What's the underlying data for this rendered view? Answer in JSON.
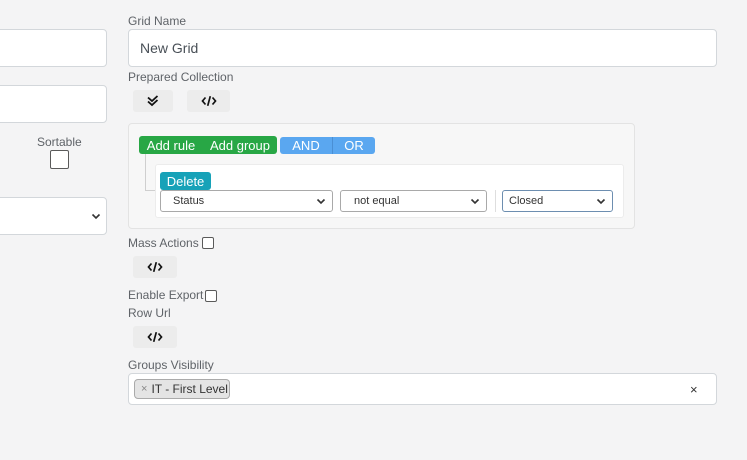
{
  "form": {
    "grid_name_label": "Grid Name",
    "grid_name_value": "New Grid",
    "prepared_collection_label": "Prepared Collection",
    "sortable_label": "Sortable",
    "mass_actions_label": "Mass Actions",
    "enable_export_label": "Enable Export",
    "row_url_label": "Row Url",
    "groups_visibility_label": "Groups Visibility"
  },
  "query_builder": {
    "add_rule_label": "Add rule",
    "add_group_label": "Add group",
    "and_label": "AND",
    "or_label": "OR",
    "delete_label": "Delete",
    "rule": {
      "field": "Status",
      "operator": "not equal",
      "value": "Closed"
    }
  },
  "groups_visibility": {
    "tags": [
      {
        "remove": "×",
        "label": "IT - First Level"
      }
    ],
    "clear": "×"
  },
  "icons": {
    "check": "double-check-icon",
    "code": "code-icon",
    "chevron": "chevron-down-icon"
  },
  "colors": {
    "green": "#28a745",
    "blue": "#5aa7f0",
    "teal": "#17a2b8"
  }
}
